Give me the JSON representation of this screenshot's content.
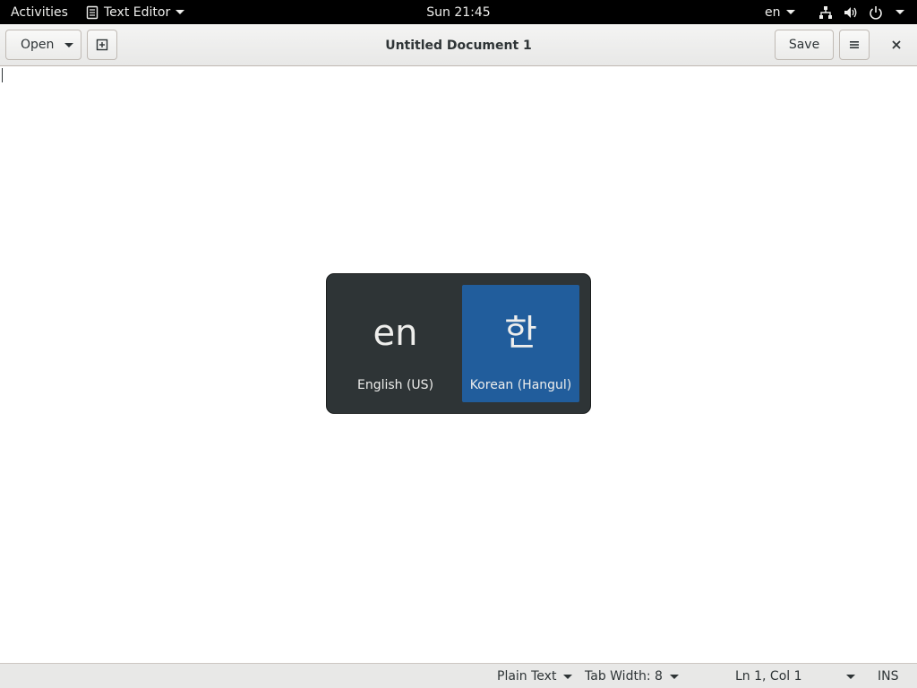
{
  "topbar": {
    "activities": "Activities",
    "app_name": "Text Editor",
    "app_icon": "text-editor-icon",
    "clock": "Sun 21:45",
    "input_source": "en",
    "icons": [
      "network-icon",
      "volume-icon",
      "power-icon"
    ]
  },
  "headerbar": {
    "open_label": "Open",
    "title": "Untitled Document 1",
    "save_label": "Save",
    "new_doc_icon": "new-document-icon",
    "menu_icon": "hamburger-menu-icon",
    "close_icon": "close-icon"
  },
  "editor": {
    "content": ""
  },
  "switcher": {
    "items": [
      {
        "symbol": "en",
        "label": "English (US)",
        "selected": false
      },
      {
        "symbol": "한",
        "label": "Korean (Hangul)",
        "selected": true
      }
    ],
    "background_color": "#2e3436",
    "selected_color": "#215d9c"
  },
  "statusbar": {
    "language": "Plain Text",
    "tab_width": "Tab Width: 8",
    "position": "Ln 1, Col 1",
    "mode": "INS"
  }
}
